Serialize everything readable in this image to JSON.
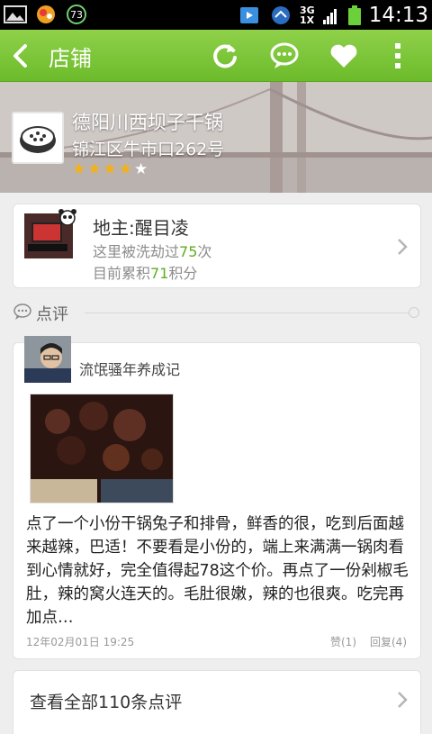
{
  "status_bar": {
    "time": "14:13",
    "network_top": "3G",
    "network_bottom": "1X",
    "notification_badge": "73",
    "icons": [
      "gallery-icon",
      "app-icon",
      "sync-icon",
      "media-icon",
      "wifi-icon",
      "signal-icon",
      "battery-icon"
    ]
  },
  "titlebar": {
    "title": "店铺",
    "actions": [
      "refresh-icon",
      "comment-icon",
      "heart-icon",
      "more-icon"
    ],
    "accent_color": "#7cc83a"
  },
  "shop": {
    "name": "德阳川西坝子干锅",
    "address": "锦江区牛市口262号",
    "rating": 4,
    "rating_max": 5
  },
  "landlord": {
    "title": "地主:醒目凌",
    "raided_prefix": "这里被洗劫过",
    "raided_count": "75",
    "raided_suffix": "次",
    "points_prefix": "目前累积",
    "points_count": "71",
    "points_suffix": "积分"
  },
  "reviews_section": {
    "label": "点评"
  },
  "review": {
    "user": "流氓骚年养成记",
    "text": "点了一个小份干锅兔子和排骨，鲜香的很，吃到后面越来越辣，巴适！不要看是小份的，端上来满满一锅肉看到心情就好，完全值得起78这个价。再点了一份剁椒毛肚，辣的窝火连天的。毛肚很嫩，辣的也很爽。吃完再加点…",
    "date": "12年02月01日 19:25",
    "likes": "赞(1)",
    "replies": "回复(4)"
  },
  "view_all": {
    "label": "查看全部110条点评"
  }
}
